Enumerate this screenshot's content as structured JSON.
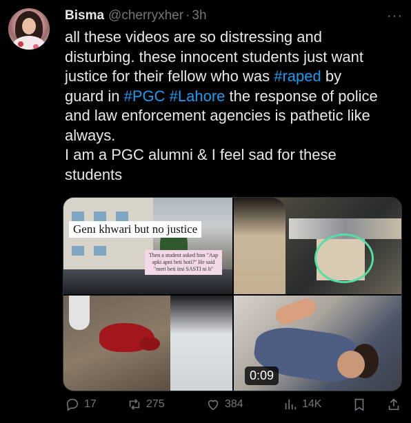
{
  "tweet": {
    "author_name": "Bisma",
    "handle": "@cherryxher",
    "separator": "·",
    "time": "3h",
    "more_label": "···",
    "text_segments": [
      {
        "text": "all these videos are so distressing and\ndisturbing. these innocent students just want\njustice for their fellow who was ",
        "type": "text"
      },
      {
        "text": "#raped",
        "type": "hashtag"
      },
      {
        "text": " by\nguard in ",
        "type": "text"
      },
      {
        "text": "#PGC",
        "type": "hashtag"
      },
      {
        "text": " ",
        "type": "text"
      },
      {
        "text": "#Lahore",
        "type": "hashtag"
      },
      {
        "text": " the response of police\nand law enforcement agencies is pathetic like\nalways.\nI am a PGC alumni & I feel sad for these\nstudents",
        "type": "text"
      }
    ],
    "media": {
      "image1_caption": "Genı khwari but no justice",
      "image1_quote": "Then a student asked him \"Aap apki apni beti hoti?\" He said \"meri beti itni SASTI ni h\"",
      "video_duration": "0:09"
    },
    "actions": {
      "replies": "17",
      "retweets": "275",
      "likes": "384",
      "views": "14K"
    }
  },
  "colors": {
    "background": "#000000",
    "text": "#e7e9ea",
    "muted": "#71767b",
    "link": "#1d9bf0",
    "highlight_circle": "#53e0a5"
  },
  "icons": [
    "avatar",
    "more-icon",
    "reply-icon",
    "retweet-icon",
    "like-icon",
    "views-icon",
    "bookmark-icon",
    "share-icon"
  ]
}
